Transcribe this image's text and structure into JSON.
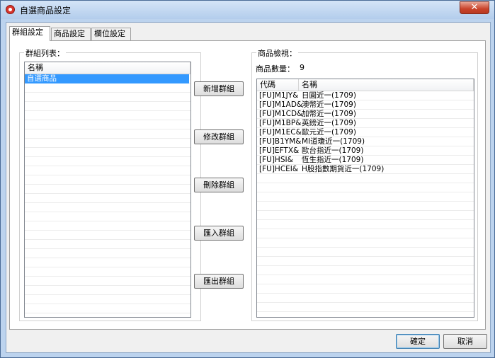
{
  "window": {
    "title": "自選商品設定",
    "close_glyph": "✕"
  },
  "tabs": [
    {
      "label": "群組設定",
      "active": true
    },
    {
      "label": "商品設定",
      "active": false
    },
    {
      "label": "欄位設定",
      "active": false
    }
  ],
  "group_list": {
    "title": "群組列表：",
    "header": "名稱",
    "items": [
      {
        "name": "自選商品",
        "selected": true
      }
    ]
  },
  "actions": {
    "add": "新增群組",
    "edit": "修改群組",
    "delete": "刪除群組",
    "import": "匯入群組",
    "export": "匯出群組"
  },
  "preview": {
    "title": "商品檢視：",
    "count_label": "商品數量：",
    "count_value": "9",
    "columns": [
      "代碼",
      "名稱"
    ],
    "rows": [
      {
        "code": "[FU]M1JY&",
        "name": "日圓近一(1709)"
      },
      {
        "code": "[FU]M1AD&",
        "name": "澳幣近一(1709)"
      },
      {
        "code": "[FU]M1CD&",
        "name": "加幣近一(1709)"
      },
      {
        "code": "[FU]M1BP&",
        "name": "英鎊近一(1709)"
      },
      {
        "code": "[FU]M1EC&",
        "name": "歐元近一(1709)"
      },
      {
        "code": "[FU]B1YM&",
        "name": "MI道瓊近一(1709)"
      },
      {
        "code": "[FU]EFTX&",
        "name": "歐台指近一(1709)"
      },
      {
        "code": "[FU]HSI&",
        "name": "恆生指近一(1709)"
      },
      {
        "code": "[FU]HCEI&",
        "name": "H股指數期貨近一(1709)"
      }
    ]
  },
  "dialog": {
    "ok": "確定",
    "cancel": "取消"
  }
}
